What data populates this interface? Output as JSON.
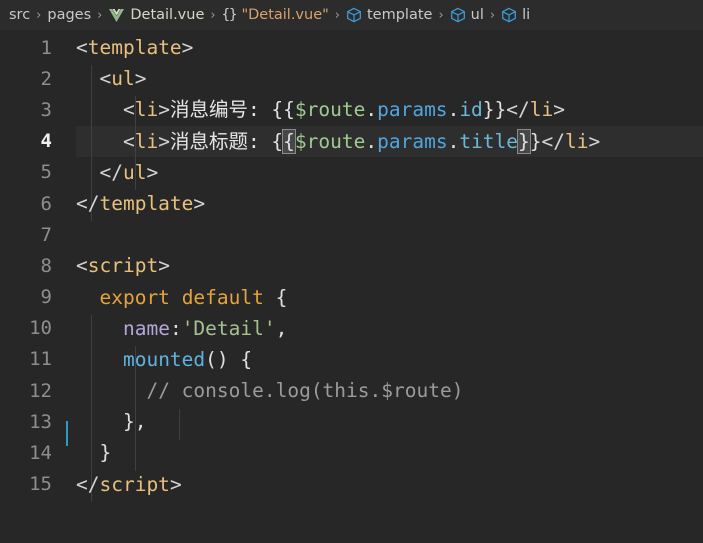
{
  "breadcrumb": {
    "items": [
      {
        "label": "src",
        "icon": "none"
      },
      {
        "label": "pages",
        "icon": "none"
      },
      {
        "label": "Detail.vue",
        "icon": "vue-logo-icon"
      },
      {
        "label": "\"Detail.vue\"",
        "icon": "braces-icon"
      },
      {
        "label": "template",
        "icon": "cube-icon"
      },
      {
        "label": "ul",
        "icon": "cube-icon"
      },
      {
        "label": "li",
        "icon": "cube-icon"
      }
    ],
    "separator": "›"
  },
  "editor": {
    "active_line": 4,
    "cursor_line": 12,
    "modified_lines": [
      3,
      4,
      12
    ],
    "lines": [
      {
        "n": "1",
        "tokens": [
          {
            "t": "<",
            "c": "t-punct"
          },
          {
            "t": "template",
            "c": "t-tag"
          },
          {
            "t": ">",
            "c": "t-punct"
          }
        ]
      },
      {
        "n": "2",
        "tokens": [
          {
            "t": "  <",
            "c": "t-punct"
          },
          {
            "t": "ul",
            "c": "t-tag"
          },
          {
            "t": ">",
            "c": "t-punct"
          }
        ]
      },
      {
        "n": "3",
        "tokens": [
          {
            "t": "    <",
            "c": "t-punct"
          },
          {
            "t": "li",
            "c": "t-tag"
          },
          {
            "t": ">",
            "c": "t-punct"
          },
          {
            "t": "消息编号: ",
            "c": "t-text"
          },
          {
            "t": "{{",
            "c": "t-white"
          },
          {
            "t": "$route",
            "c": "t-green"
          },
          {
            "t": ".",
            "c": "t-white"
          },
          {
            "t": "params",
            "c": "t-blue"
          },
          {
            "t": ".",
            "c": "t-white"
          },
          {
            "t": "id",
            "c": "t-cyan"
          },
          {
            "t": "}}",
            "c": "t-white"
          },
          {
            "t": "</",
            "c": "t-punct"
          },
          {
            "t": "li",
            "c": "t-tag"
          },
          {
            "t": ">",
            "c": "t-punct"
          }
        ]
      },
      {
        "n": "4",
        "tokens": [
          {
            "t": "    <",
            "c": "t-punct"
          },
          {
            "t": "li",
            "c": "t-tag"
          },
          {
            "t": ">",
            "c": "t-punct"
          },
          {
            "t": "消息标题: ",
            "c": "t-text"
          },
          {
            "t": "{",
            "c": "t-white"
          },
          {
            "t": "{",
            "c": "t-white bracket-match"
          },
          {
            "t": "$route",
            "c": "t-green"
          },
          {
            "t": ".",
            "c": "t-white"
          },
          {
            "t": "params",
            "c": "t-blue"
          },
          {
            "t": ".",
            "c": "t-white"
          },
          {
            "t": "title",
            "c": "t-cyan"
          },
          {
            "t": "}",
            "c": "t-white bracket-match"
          },
          {
            "t": "}",
            "c": "t-white"
          },
          {
            "t": "</",
            "c": "t-punct"
          },
          {
            "t": "li",
            "c": "t-tag"
          },
          {
            "t": ">",
            "c": "t-punct"
          }
        ]
      },
      {
        "n": "5",
        "tokens": [
          {
            "t": "  </",
            "c": "t-punct"
          },
          {
            "t": "ul",
            "c": "t-tag"
          },
          {
            "t": ">",
            "c": "t-punct"
          }
        ]
      },
      {
        "n": "6",
        "tokens": [
          {
            "t": "</",
            "c": "t-punct"
          },
          {
            "t": "template",
            "c": "t-tag"
          },
          {
            "t": ">",
            "c": "t-punct"
          }
        ]
      },
      {
        "n": "7",
        "tokens": []
      },
      {
        "n": "8",
        "tokens": [
          {
            "t": "<",
            "c": "t-punct"
          },
          {
            "t": "script",
            "c": "t-tag"
          },
          {
            "t": ">",
            "c": "t-punct"
          }
        ]
      },
      {
        "n": "9",
        "tokens": [
          {
            "t": "  ",
            "c": "t-punct"
          },
          {
            "t": "export",
            "c": "t-orange"
          },
          {
            "t": " ",
            "c": "t-punct"
          },
          {
            "t": "default",
            "c": "t-orange"
          },
          {
            "t": " ",
            "c": "t-punct"
          },
          {
            "t": "{",
            "c": "t-white"
          }
        ]
      },
      {
        "n": "10",
        "tokens": [
          {
            "t": "    ",
            "c": "t-punct"
          },
          {
            "t": "name",
            "c": "t-lav"
          },
          {
            "t": ":",
            "c": "t-white"
          },
          {
            "t": "'Detail'",
            "c": "t-str"
          },
          {
            "t": ",",
            "c": "t-white"
          }
        ]
      },
      {
        "n": "11",
        "tokens": [
          {
            "t": "    ",
            "c": "t-punct"
          },
          {
            "t": "mounted",
            "c": "t-fn"
          },
          {
            "t": "()",
            "c": "t-white"
          },
          {
            "t": " ",
            "c": "t-punct"
          },
          {
            "t": "{",
            "c": "t-white"
          }
        ]
      },
      {
        "n": "12",
        "tokens": [
          {
            "t": "      ",
            "c": "t-punct"
          },
          {
            "t": "// console.log(this.$route)",
            "c": "t-comment"
          }
        ]
      },
      {
        "n": "13",
        "tokens": [
          {
            "t": "    ",
            "c": "t-punct"
          },
          {
            "t": "},",
            "c": "t-white"
          }
        ]
      },
      {
        "n": "14",
        "tokens": [
          {
            "t": "  ",
            "c": "t-punct"
          },
          {
            "t": "}",
            "c": "t-white"
          }
        ]
      },
      {
        "n": "15",
        "tokens": [
          {
            "t": "</",
            "c": "t-punct"
          },
          {
            "t": "script",
            "c": "t-tag"
          },
          {
            "t": ">",
            "c": "t-punct"
          }
        ]
      }
    ]
  },
  "colors": {
    "editor_background": "#272727",
    "breadcrumb_background": "#2c2c2c",
    "change_marker": "#1b7c9e",
    "cursor": "#2b9bc4",
    "tag": "#e8c07d",
    "keyword": "#e5a33c",
    "string": "#a7c08f",
    "comment": "#9b9b9b"
  }
}
